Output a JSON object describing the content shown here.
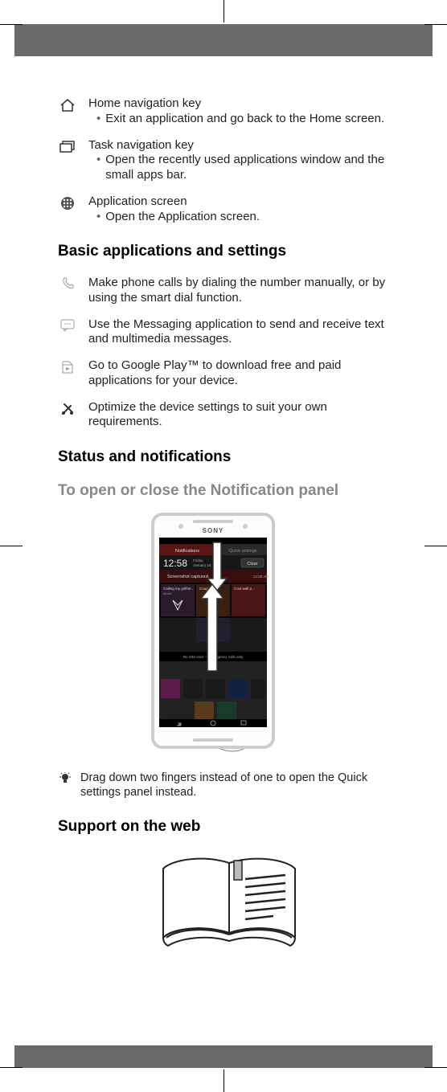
{
  "navKeys": [
    {
      "title": "Home navigation key",
      "bullet": "Exit an application and go back to the Home screen."
    },
    {
      "title": "Task navigation key",
      "bullet": "Open the recently used applications window and the small apps bar."
    },
    {
      "title": "Application screen",
      "bullet": "Open the Application screen."
    }
  ],
  "headings": {
    "basicApps": "Basic applications and settings",
    "status": "Status and notifications",
    "notificationPanel": "To open or close the Notification panel",
    "supportWeb": "Support on the web"
  },
  "basicApps": [
    "Make phone calls by dialing the number manually, or by using the smart dial function.",
    "Use the Messaging application to send and receive text and multimedia messages.",
    "Go to Google Play™ to download free and paid applications for your device.",
    "Optimize the device settings to suit your own requirements."
  ],
  "tip": "Drag down two fingers instead of one to open the Quick settings panel instead.",
  "phoneScreen": {
    "brand": "SONY",
    "tabs": {
      "left": "Notifications",
      "right": "Quick settings"
    },
    "time": "12:58",
    "dateTop": "Friday",
    "dateBottom": "January 16, 1970",
    "clear": "Clear",
    "notif1": "Screenshot captured.",
    "notif1time": "12:58 AM",
    "call": "Calling my girlfrie…",
    "callSub": "Movie",
    "tile1": "CouponPro",
    "tile2": "Cool wall p…",
    "noSIM": "No SIM card — Emergency calls only"
  }
}
